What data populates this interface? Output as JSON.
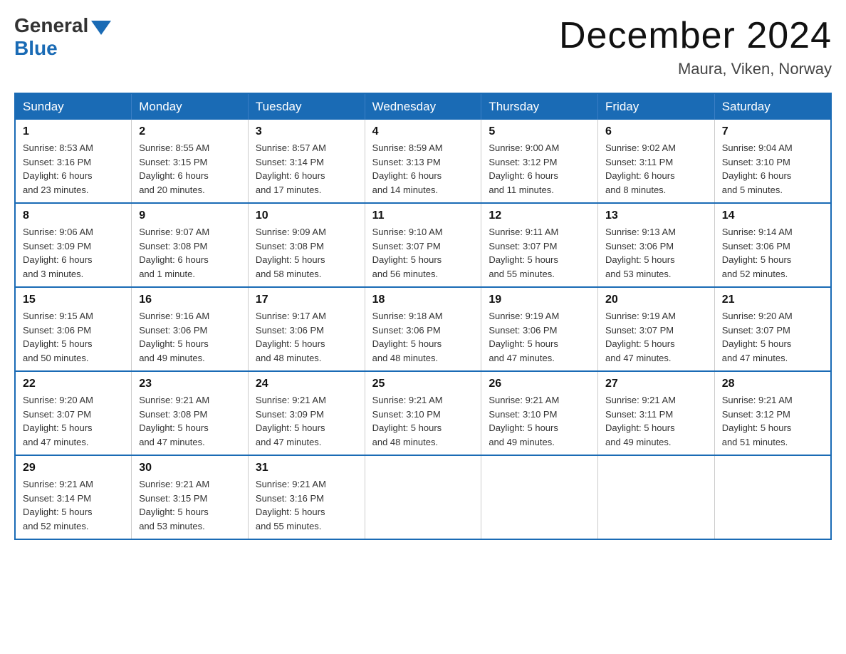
{
  "header": {
    "logo_general": "General",
    "logo_blue": "Blue",
    "title": "December 2024",
    "location": "Maura, Viken, Norway"
  },
  "days_of_week": [
    "Sunday",
    "Monday",
    "Tuesday",
    "Wednesday",
    "Thursday",
    "Friday",
    "Saturday"
  ],
  "weeks": [
    [
      {
        "day": "1",
        "sunrise": "8:53 AM",
        "sunset": "3:16 PM",
        "daylight": "6 hours and 23 minutes."
      },
      {
        "day": "2",
        "sunrise": "8:55 AM",
        "sunset": "3:15 PM",
        "daylight": "6 hours and 20 minutes."
      },
      {
        "day": "3",
        "sunrise": "8:57 AM",
        "sunset": "3:14 PM",
        "daylight": "6 hours and 17 minutes."
      },
      {
        "day": "4",
        "sunrise": "8:59 AM",
        "sunset": "3:13 PM",
        "daylight": "6 hours and 14 minutes."
      },
      {
        "day": "5",
        "sunrise": "9:00 AM",
        "sunset": "3:12 PM",
        "daylight": "6 hours and 11 minutes."
      },
      {
        "day": "6",
        "sunrise": "9:02 AM",
        "sunset": "3:11 PM",
        "daylight": "6 hours and 8 minutes."
      },
      {
        "day": "7",
        "sunrise": "9:04 AM",
        "sunset": "3:10 PM",
        "daylight": "6 hours and 5 minutes."
      }
    ],
    [
      {
        "day": "8",
        "sunrise": "9:06 AM",
        "sunset": "3:09 PM",
        "daylight": "6 hours and 3 minutes."
      },
      {
        "day": "9",
        "sunrise": "9:07 AM",
        "sunset": "3:08 PM",
        "daylight": "6 hours and 1 minute."
      },
      {
        "day": "10",
        "sunrise": "9:09 AM",
        "sunset": "3:08 PM",
        "daylight": "5 hours and 58 minutes."
      },
      {
        "day": "11",
        "sunrise": "9:10 AM",
        "sunset": "3:07 PM",
        "daylight": "5 hours and 56 minutes."
      },
      {
        "day": "12",
        "sunrise": "9:11 AM",
        "sunset": "3:07 PM",
        "daylight": "5 hours and 55 minutes."
      },
      {
        "day": "13",
        "sunrise": "9:13 AM",
        "sunset": "3:06 PM",
        "daylight": "5 hours and 53 minutes."
      },
      {
        "day": "14",
        "sunrise": "9:14 AM",
        "sunset": "3:06 PM",
        "daylight": "5 hours and 52 minutes."
      }
    ],
    [
      {
        "day": "15",
        "sunrise": "9:15 AM",
        "sunset": "3:06 PM",
        "daylight": "5 hours and 50 minutes."
      },
      {
        "day": "16",
        "sunrise": "9:16 AM",
        "sunset": "3:06 PM",
        "daylight": "5 hours and 49 minutes."
      },
      {
        "day": "17",
        "sunrise": "9:17 AM",
        "sunset": "3:06 PM",
        "daylight": "5 hours and 48 minutes."
      },
      {
        "day": "18",
        "sunrise": "9:18 AM",
        "sunset": "3:06 PM",
        "daylight": "5 hours and 48 minutes."
      },
      {
        "day": "19",
        "sunrise": "9:19 AM",
        "sunset": "3:06 PM",
        "daylight": "5 hours and 47 minutes."
      },
      {
        "day": "20",
        "sunrise": "9:19 AM",
        "sunset": "3:07 PM",
        "daylight": "5 hours and 47 minutes."
      },
      {
        "day": "21",
        "sunrise": "9:20 AM",
        "sunset": "3:07 PM",
        "daylight": "5 hours and 47 minutes."
      }
    ],
    [
      {
        "day": "22",
        "sunrise": "9:20 AM",
        "sunset": "3:07 PM",
        "daylight": "5 hours and 47 minutes."
      },
      {
        "day": "23",
        "sunrise": "9:21 AM",
        "sunset": "3:08 PM",
        "daylight": "5 hours and 47 minutes."
      },
      {
        "day": "24",
        "sunrise": "9:21 AM",
        "sunset": "3:09 PM",
        "daylight": "5 hours and 47 minutes."
      },
      {
        "day": "25",
        "sunrise": "9:21 AM",
        "sunset": "3:10 PM",
        "daylight": "5 hours and 48 minutes."
      },
      {
        "day": "26",
        "sunrise": "9:21 AM",
        "sunset": "3:10 PM",
        "daylight": "5 hours and 49 minutes."
      },
      {
        "day": "27",
        "sunrise": "9:21 AM",
        "sunset": "3:11 PM",
        "daylight": "5 hours and 49 minutes."
      },
      {
        "day": "28",
        "sunrise": "9:21 AM",
        "sunset": "3:12 PM",
        "daylight": "5 hours and 51 minutes."
      }
    ],
    [
      {
        "day": "29",
        "sunrise": "9:21 AM",
        "sunset": "3:14 PM",
        "daylight": "5 hours and 52 minutes."
      },
      {
        "day": "30",
        "sunrise": "9:21 AM",
        "sunset": "3:15 PM",
        "daylight": "5 hours and 53 minutes."
      },
      {
        "day": "31",
        "sunrise": "9:21 AM",
        "sunset": "3:16 PM",
        "daylight": "5 hours and 55 minutes."
      },
      null,
      null,
      null,
      null
    ]
  ],
  "labels": {
    "sunrise": "Sunrise:",
    "sunset": "Sunset:",
    "daylight": "Daylight:"
  },
  "colors": {
    "header_bg": "#1a6bb5",
    "border": "#1a6bb5"
  }
}
